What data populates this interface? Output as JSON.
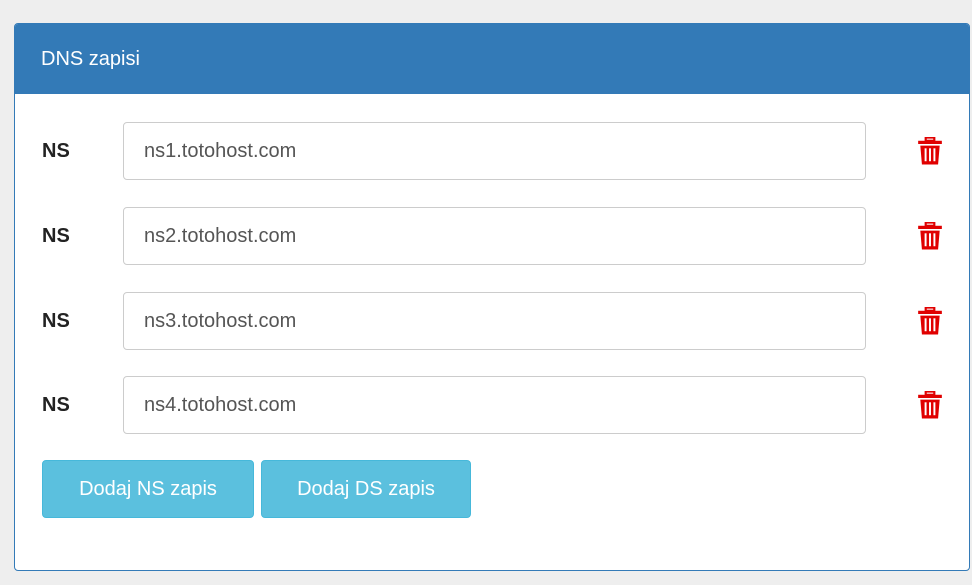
{
  "panel": {
    "title": "DNS zapisi"
  },
  "records": [
    {
      "type": "NS",
      "value": "ns1.totohost.com"
    },
    {
      "type": "NS",
      "value": "ns2.totohost.com"
    },
    {
      "type": "NS",
      "value": "ns3.totohost.com"
    },
    {
      "type": "NS",
      "value": "ns4.totohost.com"
    }
  ],
  "actions": {
    "add_ns_label": "Dodaj NS zapis",
    "add_ds_label": "Dodaj DS zapis"
  },
  "icons": {
    "delete": "trash-icon"
  },
  "colors": {
    "header_bg": "#337ab7",
    "button_bg": "#5bc0de",
    "delete_icon": "#e00000"
  }
}
